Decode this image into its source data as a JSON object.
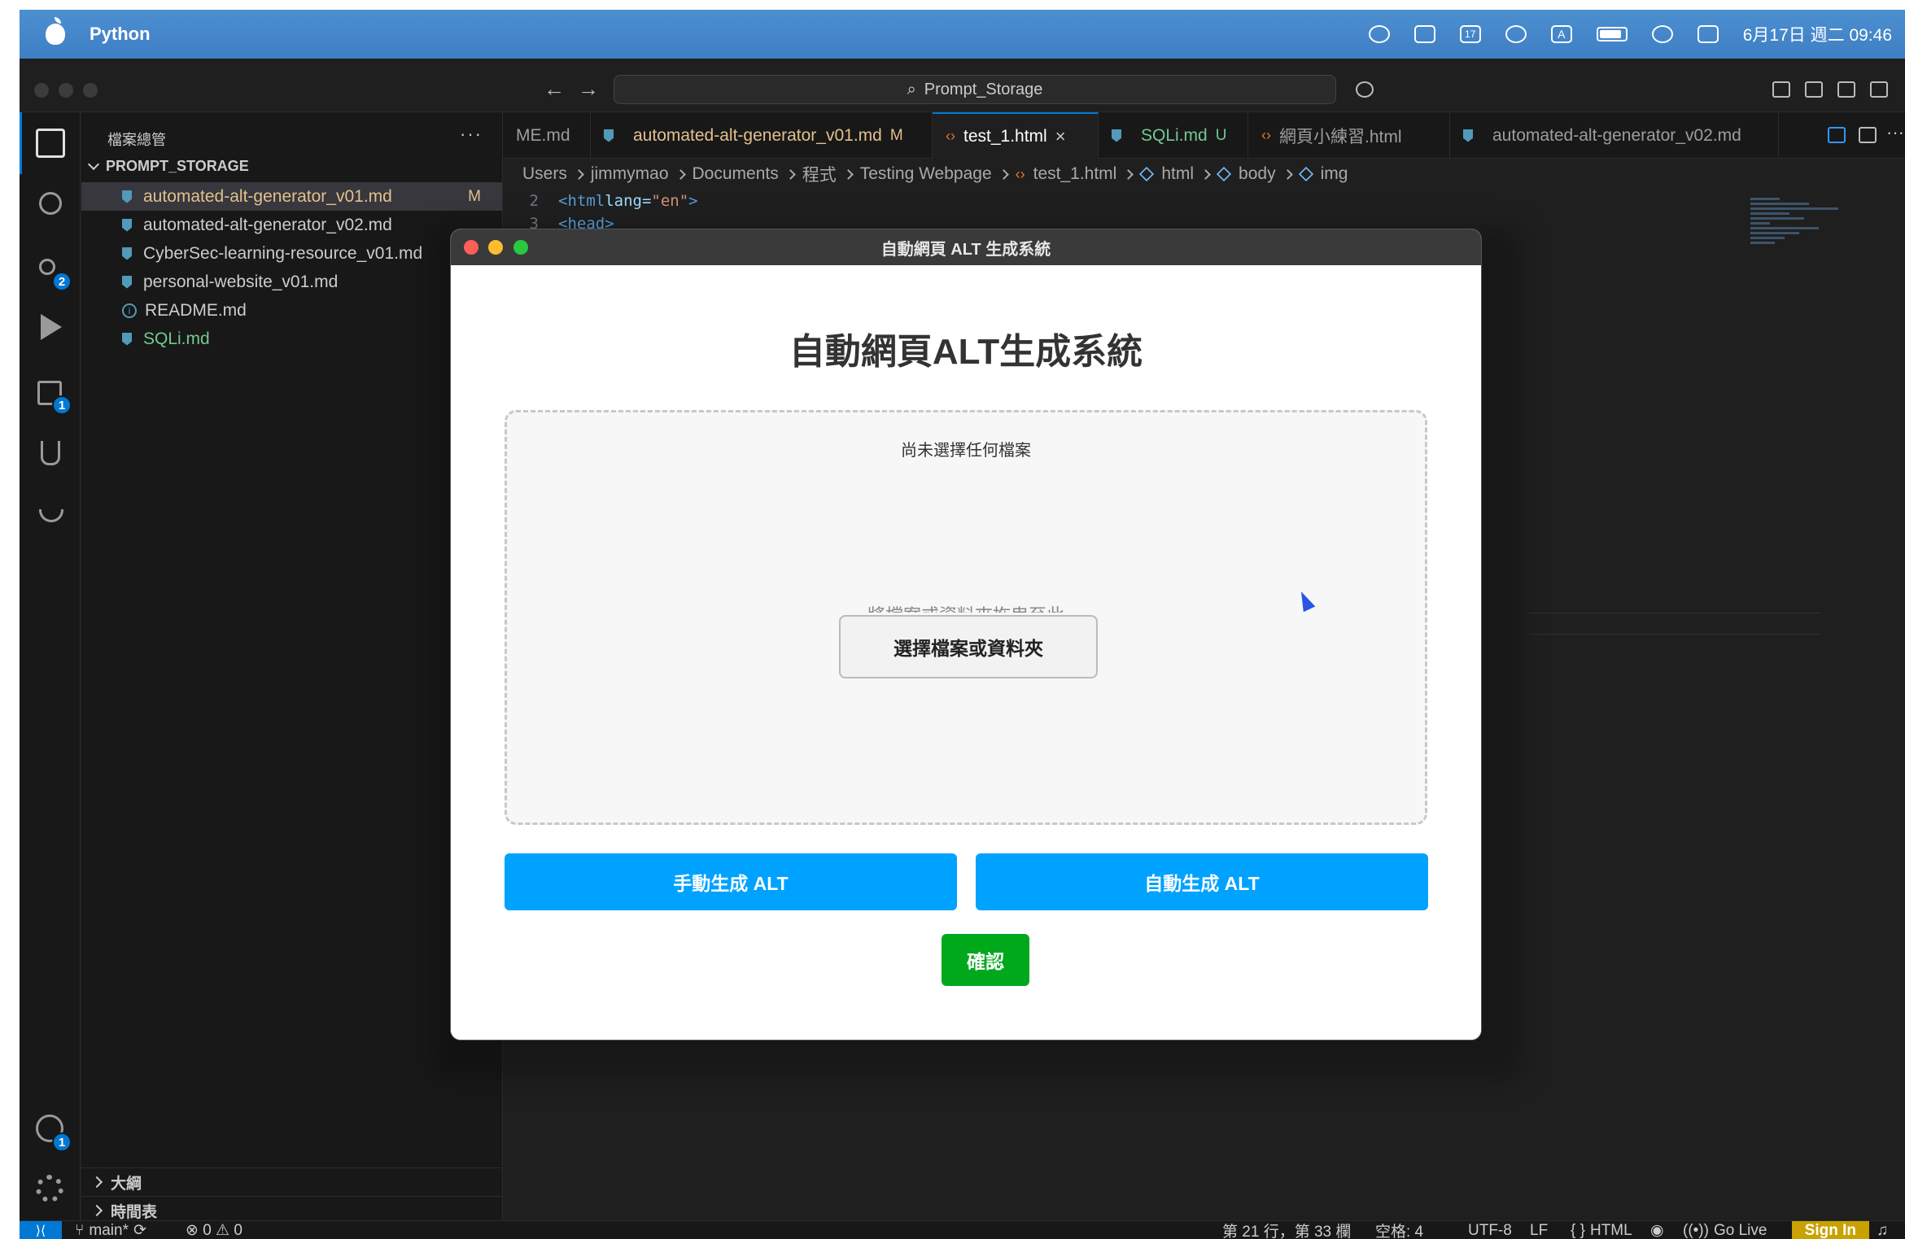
{
  "menubar": {
    "app_name": "Python",
    "datetime": "6月17日 週二 09:46",
    "calendar_day": "17",
    "input_method": "A"
  },
  "titlebar": {
    "command_center": "Prompt_Storage"
  },
  "activity": {
    "scm_badge": "2",
    "extensions_badge": "1",
    "account_badge": "1"
  },
  "sidebar": {
    "title": "檔案總管",
    "more": "···",
    "section": "PROMPT_STORAGE",
    "files": [
      {
        "name": "automated-alt-generator_v01.md",
        "status": "M"
      },
      {
        "name": "automated-alt-generator_v02.md",
        "status": ""
      },
      {
        "name": "CyberSec-learning-resource_v01.md",
        "status": ""
      },
      {
        "name": "personal-website_v01.md",
        "status": ""
      },
      {
        "name": "README.md",
        "status": ""
      },
      {
        "name": "SQLi.md",
        "status": ""
      }
    ],
    "outline": "大綱",
    "timeline": "時間表"
  },
  "tabs": [
    {
      "label": "ME.md",
      "flag": ""
    },
    {
      "label": "automated-alt-generator_v01.md",
      "flag": "M"
    },
    {
      "label": "test_1.html",
      "flag": ""
    },
    {
      "label": "SQLi.md",
      "flag": "U"
    },
    {
      "label": "網頁小練習.html",
      "flag": ""
    },
    {
      "label": "automated-alt-generator_v02.md",
      "flag": ""
    }
  ],
  "breadcrumb": [
    "Users",
    "jimmymao",
    "Documents",
    "程式",
    "Testing Webpage",
    "test_1.html",
    "html",
    "body",
    "img"
  ],
  "code": [
    {
      "line": "2",
      "tag": "<html",
      "attr": " lang=",
      "str": "\"en\"",
      "end": ">"
    },
    {
      "line": "3",
      "tag": "<head>",
      "attr": "",
      "str": "",
      "end": ""
    }
  ],
  "statusbar": {
    "branch": "main*",
    "problems": "⊗ 0 ⚠ 0",
    "position": "第 21 行，第 33 欄",
    "spaces": "空格: 4",
    "encoding": "UTF-8",
    "eol": "LF",
    "language": "HTML",
    "golive": "Go Live",
    "signin": "Sign In"
  },
  "modal": {
    "window_title": "自動網頁 ALT 生成系統",
    "heading": "自動網頁ALT生成系統",
    "no_file": "尚未選擇任何檔案",
    "drop_hint": "將檔案或資料夾拖曳至此",
    "choose_button": "選擇檔案或資料夾",
    "manual_button": "手動生成 ALT",
    "auto_button": "自動生成 ALT",
    "confirm_button": "確認",
    "colors": {
      "primary": "#00a2ff",
      "confirm": "#00a81c"
    }
  }
}
